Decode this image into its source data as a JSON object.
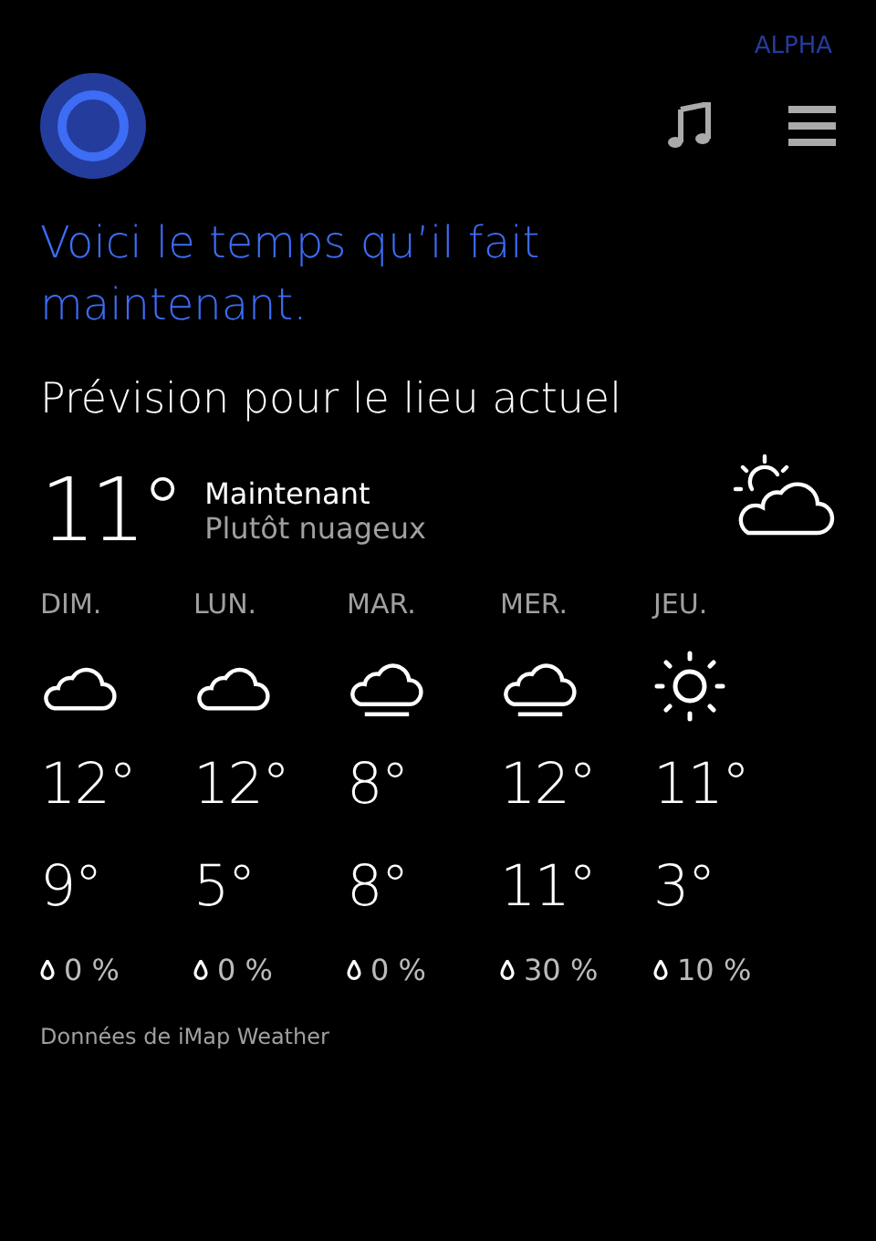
{
  "badge": "ALPHA",
  "headline": "Voici le temps qu’il fait maintenant.",
  "section_title": "Prévision pour le lieu actuel",
  "current": {
    "temperature": "11°",
    "label": "Maintenant",
    "condition": "Plutôt nuageux",
    "kind": "partly-cloudy"
  },
  "days": [
    {
      "day": "DIM.",
      "kind": "cloudy",
      "high": "12°",
      "low": "9°",
      "rain": "0 %"
    },
    {
      "day": "LUN.",
      "kind": "cloudy",
      "high": "12°",
      "low": "5°",
      "rain": "0 %"
    },
    {
      "day": "MAR.",
      "kind": "fog",
      "high": "8°",
      "low": "8°",
      "rain": "0 %"
    },
    {
      "day": "MER.",
      "kind": "fog",
      "high": "12°",
      "low": "11°",
      "rain": "30 %"
    },
    {
      "day": "JEU.",
      "kind": "sunny",
      "high": "11°",
      "low": "3°",
      "rain": "10 %"
    }
  ],
  "source": "Données de iMap Weather"
}
